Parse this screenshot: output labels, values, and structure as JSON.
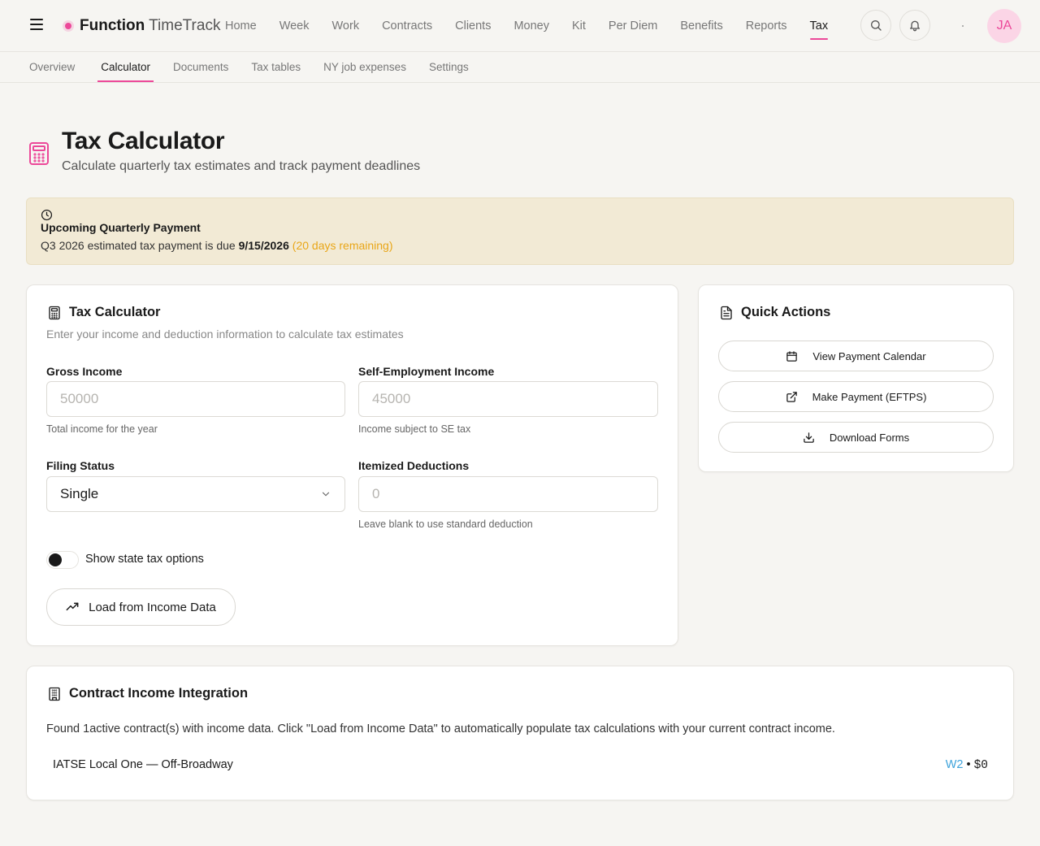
{
  "nav": {
    "brand_strong": "Function",
    "brand_light": " TimeTrack",
    "links": [
      "Home",
      "Week",
      "Work",
      "Contracts",
      "Clients",
      "Money",
      "Kit",
      "Per Diem",
      "Benefits",
      "Reports",
      "Tax"
    ],
    "active_link": "Tax",
    "avatar_initials": "JA",
    "accent_color": "#ec4899"
  },
  "subnav": {
    "tabs": [
      "Overview",
      "Calculator",
      "Documents",
      "Tax tables",
      "NY job expenses",
      "Settings"
    ],
    "active_tab": "Calculator"
  },
  "header": {
    "title": "Tax Calculator",
    "subtitle": "Calculate quarterly tax estimates and track payment deadlines"
  },
  "alert": {
    "title": "Upcoming Quarterly Payment",
    "text_before": "Q3 2026 estimated tax payment is due ",
    "due_date": "9/15/2026",
    "remaining": " (20 days remaining)"
  },
  "calculator": {
    "title": "Tax Calculator",
    "description": "Enter your income and deduction information to calculate tax estimates",
    "gross_income": {
      "label": "Gross Income",
      "placeholder": "50000",
      "value": "",
      "help": "Total income for the year"
    },
    "se_income": {
      "label": "Self-Employment Income",
      "placeholder": "45000",
      "value": "",
      "help": "Income subject to SE tax"
    },
    "filing_status": {
      "label": "Filing Status",
      "value": "Single"
    },
    "itemized": {
      "label": "Itemized Deductions",
      "placeholder": "0",
      "value": "",
      "help": "Leave blank to use standard deduction"
    },
    "state_toggle": {
      "label": "Show state tax options",
      "on": false
    },
    "load_button": "Load from Income Data"
  },
  "quick_actions": {
    "title": "Quick Actions",
    "buttons": [
      "View Payment Calendar",
      "Make Payment (EFTPS)",
      "Download Forms"
    ]
  },
  "contract_income": {
    "title": "Contract Income Integration",
    "text": "Found 1active contract(s) with income data. Click \"Load from Income Data\" to automatically populate tax calculations with your current contract income.",
    "rows": [
      {
        "name": "IATSE Local One — Off-Broadway",
        "type": "W2",
        "separator": " • ",
        "amount": "$0"
      }
    ]
  }
}
